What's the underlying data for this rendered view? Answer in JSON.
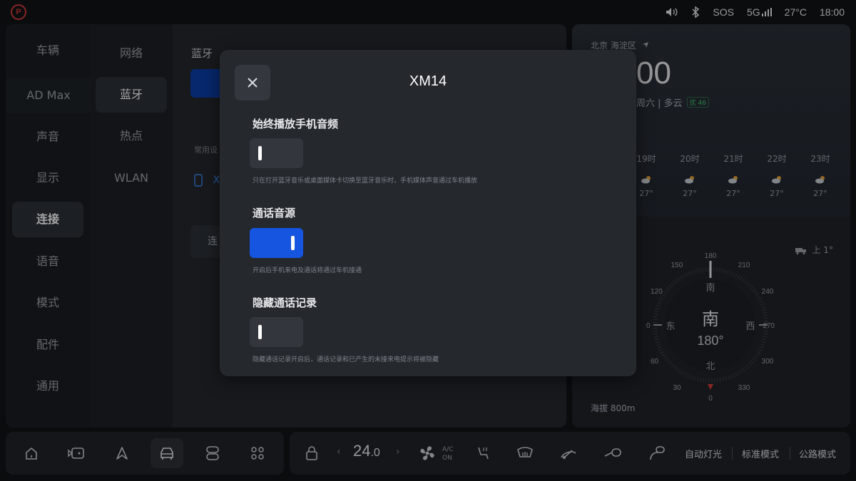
{
  "status_bar": {
    "parking_icon": "parking-brake-icon",
    "sos": "SOS",
    "network": "5G",
    "temperature": "27°C",
    "time": "18:00"
  },
  "settings": {
    "primary_nav": [
      "车辆",
      "AD Max",
      "声音",
      "显示",
      "连接",
      "语音",
      "模式",
      "配件",
      "通用"
    ],
    "primary_active": "连接",
    "secondary_nav": [
      "网络",
      "蓝牙",
      "热点",
      "WLAN"
    ],
    "secondary_active": "蓝牙",
    "section_title": "蓝牙",
    "common_devices_label": "常用设",
    "device_partial": "X",
    "connect_button": "连"
  },
  "weather": {
    "location": "北京 海淀区",
    "time_partial": "00",
    "date_partial": "周六 | 多云",
    "aqi": "优 46",
    "hours": [
      {
        "label": "19时",
        "temp": "27°"
      },
      {
        "label": "20时",
        "temp": "27°"
      },
      {
        "label": "21时",
        "temp": "27°"
      },
      {
        "label": "22时",
        "temp": "27°"
      },
      {
        "label": "23时",
        "temp": "27°"
      }
    ],
    "elevation_change": "上 1°",
    "altitude": "海拔 800m"
  },
  "compass": {
    "heading_label": "南",
    "heading_degrees": "180°",
    "degree_labels": [
      "180",
      "210",
      "240",
      "270",
      "300",
      "330",
      "0",
      "30",
      "60",
      "0",
      "120",
      "150"
    ],
    "cardinals": {
      "north": "北",
      "south": "南",
      "east": "东",
      "west": "西"
    }
  },
  "modal": {
    "title": "XM14",
    "options": [
      {
        "title": "始终播放手机音频",
        "enabled": false,
        "description": "只在打开蓝牙音乐或桌面媒体卡切换至蓝牙音乐时，手机媒体声音通过车机播放"
      },
      {
        "title": "通话音源",
        "enabled": true,
        "description": "开启后手机来电及通话将通过车机接通"
      },
      {
        "title": "隐藏通话记录",
        "enabled": false,
        "description": "隐藏通话记录开启后，通话记录和已产生的未接来电提示将被隐藏"
      }
    ]
  },
  "dock": {
    "left_icons": [
      "home-icon",
      "media-icon",
      "navigation-icon",
      "car-icon",
      "controls-icon",
      "apps-icon"
    ],
    "active_icon": "car-icon",
    "temperature_int": "24",
    "temperature_dec": ".0",
    "ac_label_top": "A/C",
    "ac_label_bottom": "ON",
    "modes": [
      "自动灯光",
      "标准模式",
      "公路模式"
    ]
  },
  "colors": {
    "accent_blue": "#1555e0",
    "parking_red": "#d23a3a",
    "aqi_green": "#3bc46a"
  }
}
